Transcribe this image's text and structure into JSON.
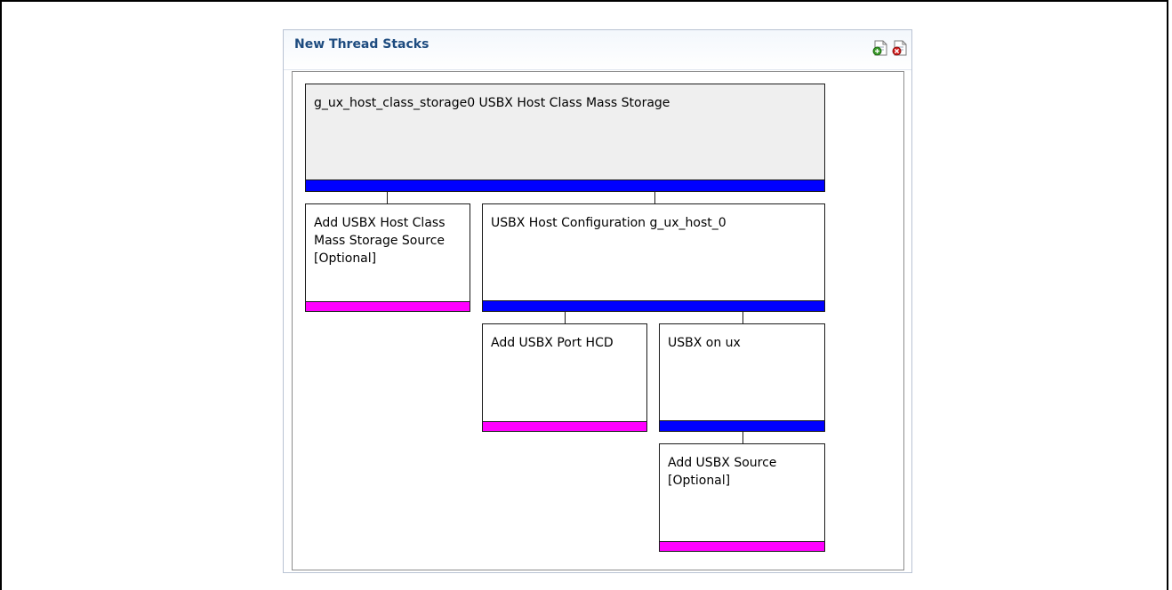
{
  "panel": {
    "title": "New Thread Stacks"
  },
  "toolbar": {
    "add_icon": "add-stack-icon",
    "remove_icon": "remove-stack-icon"
  },
  "colors": {
    "required_bar": "#0000ff",
    "optional_bar": "#ff00ff",
    "root_fill": "#efefef"
  },
  "modules": {
    "root": {
      "label": "g_ux_host_class_storage0 USBX Host Class Mass Storage",
      "status": "required"
    },
    "class_source": {
      "label": "Add USBX Host Class Mass Storage Source [Optional]",
      "status": "optional"
    },
    "host_config": {
      "label": "USBX Host Configuration g_ux_host_0",
      "status": "required"
    },
    "port_hcd": {
      "label": "Add USBX Port HCD",
      "status": "optional"
    },
    "usbx_on_ux": {
      "label": "USBX on ux",
      "status": "required"
    },
    "usbx_source": {
      "label": "Add USBX Source [Optional]",
      "status": "optional"
    }
  }
}
